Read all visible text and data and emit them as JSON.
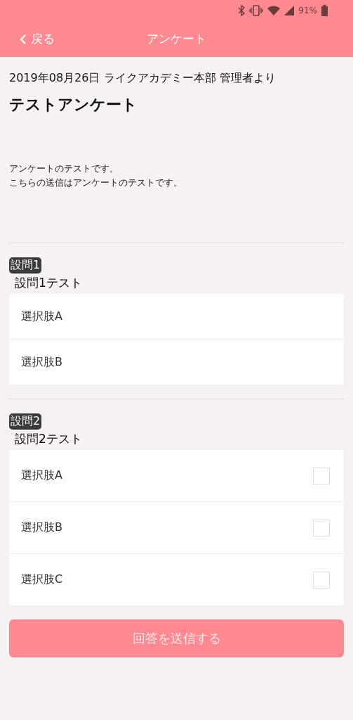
{
  "status_bar": {
    "battery": "91%"
  },
  "header": {
    "back": "戻る",
    "title": "アンケート"
  },
  "meta": "2019年08月26日 ライクアカデミー本部 管理者より",
  "title": "テストアンケート",
  "description": [
    "アンケートのテストです。",
    "こちらの送信はアンケートのテストです。"
  ],
  "questions": [
    {
      "badge": "設問1",
      "text": "設問1テスト",
      "kind": "single",
      "options": [
        {
          "label": "選択肢A"
        },
        {
          "label": "選択肢B"
        }
      ]
    },
    {
      "badge": "設問2",
      "text": "設問2テスト",
      "kind": "multiple",
      "options": [
        {
          "label": "選択肢A",
          "checked": false
        },
        {
          "label": "選択肢B",
          "checked": false
        },
        {
          "label": "選択肢C",
          "checked": false
        }
      ]
    }
  ],
  "submit": {
    "label": "回答を送信する",
    "disabled": true
  }
}
